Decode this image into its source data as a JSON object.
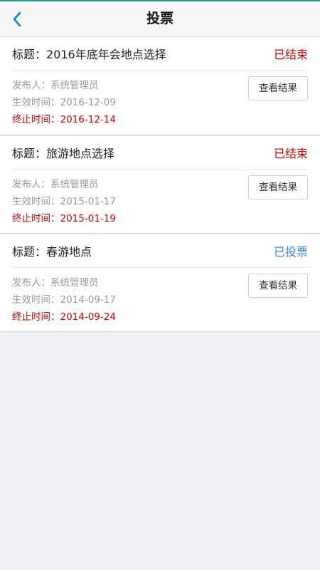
{
  "navbar": {
    "title": "投票",
    "back_icon": "chevron-left-icon",
    "accent_color": "#1a7de0"
  },
  "colors": {
    "ended": "#d40000",
    "voted": "#3a86d9",
    "top_line": "#169f8a"
  },
  "votes": [
    {
      "title": "标题：2016年底年会地点选择",
      "status": "已结束",
      "status_type": "ended",
      "publisher": "发布人：系统管理员",
      "start": "生效时间：2016-12-09",
      "end": "终止时间：2016-12-14",
      "button": "查看结果"
    },
    {
      "title": "标题：旅游地点选择",
      "status": "已结束",
      "status_type": "ended",
      "publisher": "发布人：系统管理员",
      "start": "生效时间：2015-01-17",
      "end": "终止时间：2015-01-19",
      "button": "查看结果"
    },
    {
      "title": "标题：春游地点",
      "status": "已投票",
      "status_type": "voted",
      "publisher": "发布人：系统管理员",
      "start": "生效时间：2014-09-17",
      "end": "终止时间：2014-09-24",
      "button": "查看结果"
    }
  ]
}
